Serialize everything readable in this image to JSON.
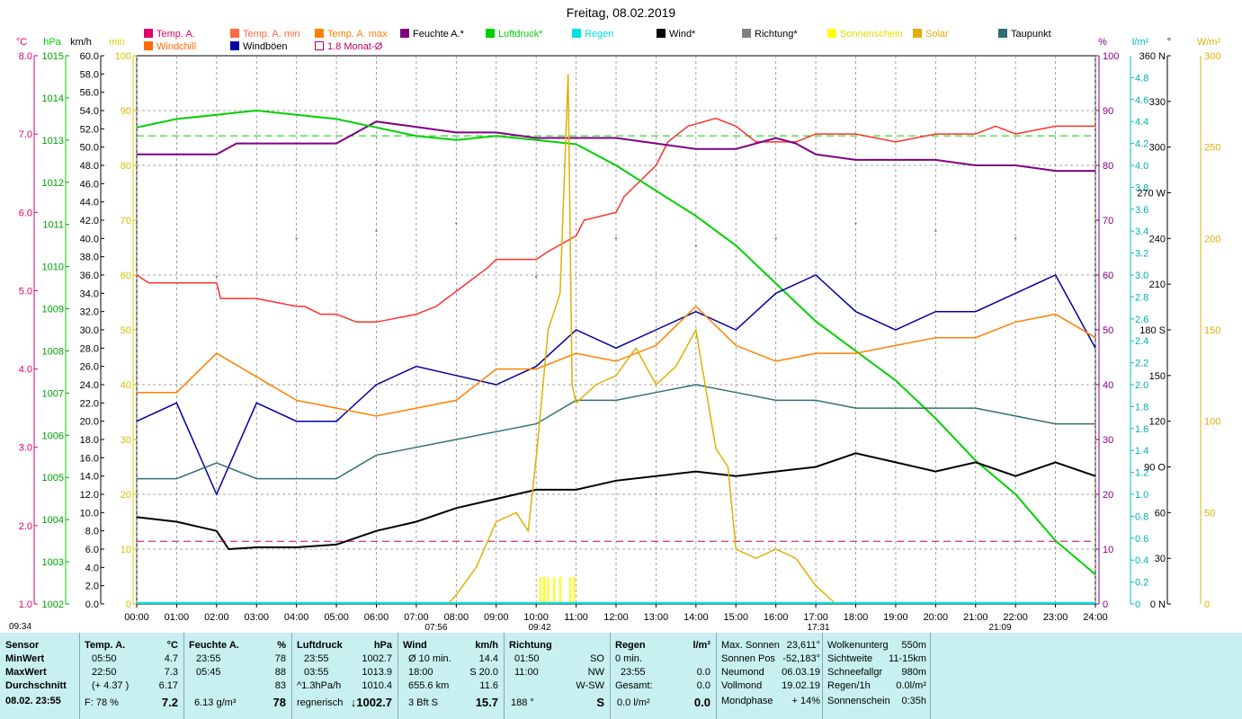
{
  "title": "Freitag, 08.02.2019",
  "legend": [
    {
      "label": "Temp. A.",
      "color": "#e0006a",
      "hollow": false
    },
    {
      "label": "Temp. A. min",
      "color": "#ff6a40",
      "hollow": false
    },
    {
      "label": "Temp. A. max",
      "color": "#ff8000",
      "hollow": false
    },
    {
      "label": "Feuchte A.*",
      "color": "#800080",
      "hollow": false
    },
    {
      "label": "Luftdruck*",
      "color": "#00d000",
      "hollow": false
    },
    {
      "label": "Regen",
      "color": "#00e0e0",
      "hollow": false
    },
    {
      "label": "Wind*",
      "color": "#000000",
      "hollow": false
    },
    {
      "label": "Richtung*",
      "color": "#808080",
      "hollow": false
    },
    {
      "label": "Sonnenschein",
      "color": "#ffff00",
      "hollow": false
    },
    {
      "label": "Solar",
      "color": "#e0b000",
      "hollow": false
    },
    {
      "label": "Taupunkt",
      "color": "#2e7070",
      "hollow": false
    },
    {
      "label": "Windchill",
      "color": "#ff6a00",
      "hollow": false
    },
    {
      "label": "Windböen",
      "color": "#0000a0",
      "hollow": false
    },
    {
      "label": "1.8 Monat-Ø",
      "color": "#c00060",
      "hollow": true
    }
  ],
  "axes": {
    "left_units": [
      "°C",
      "hPa",
      "km/h",
      "min"
    ],
    "right_units": [
      "%",
      "l/m²",
      "°",
      "W/m²"
    ],
    "temp_ticks": [
      "8.0",
      "7.0",
      "6.0",
      "5.0",
      "4.0",
      "3.0",
      "2.0",
      "1.0"
    ],
    "hpa_ticks": [
      "1015",
      "1014",
      "1013",
      "1012",
      "1011",
      "1010",
      "1009",
      "1008",
      "1007",
      "1006",
      "1005",
      "1004",
      "1003",
      "1002"
    ],
    "kmh_ticks": [
      "60.0",
      "58.0",
      "56.0",
      "54.0",
      "52.0",
      "50.0",
      "48.0",
      "46.0",
      "44.0",
      "42.0",
      "40.0",
      "38.0",
      "36.0",
      "34.0",
      "32.0",
      "30.0",
      "28.0",
      "26.0",
      "24.0",
      "22.0",
      "20.0",
      "18.0",
      "16.0",
      "14.0",
      "12.0",
      "10.0",
      "8.0",
      "6.0",
      "4.0",
      "2.0",
      "0.0"
    ],
    "min_ticks": [
      "100",
      "90",
      "80",
      "70",
      "60",
      "50",
      "40",
      "30",
      "20",
      "10",
      "0"
    ],
    "pct_ticks": [
      "100",
      "90",
      "80",
      "70",
      "60",
      "50",
      "40",
      "30",
      "20",
      "10",
      "0"
    ],
    "lm2_ticks": [
      "4.8",
      "4.6",
      "4.4",
      "4.2",
      "4.0",
      "3.8",
      "3.6",
      "3.4",
      "3.2",
      "3.0",
      "2.8",
      "2.6",
      "2.4",
      "2.2",
      "2.0",
      "1.8",
      "1.6",
      "1.4",
      "1.2",
      "1.0",
      "0.8",
      "0.6",
      "0.4",
      "0.2",
      "0"
    ],
    "deg_ticks": [
      "360 N",
      "330",
      "300",
      "270 W",
      "240",
      "210",
      "180 S",
      "150",
      "120",
      "90 O",
      "60",
      "30",
      "0 N"
    ],
    "wm2_ticks": [
      "300",
      "250",
      "200",
      "150",
      "100",
      "50",
      "0"
    ],
    "x_ticks": [
      "00:00",
      "01:00",
      "02:00",
      "03:00",
      "04:00",
      "05:00",
      "06:00",
      "07:00",
      "08:00",
      "09:00",
      "10:00",
      "11:00",
      "12:00",
      "13:00",
      "14:00",
      "15:00",
      "16:00",
      "17:00",
      "18:00",
      "19:00",
      "20:00",
      "21:00",
      "22:00",
      "23:00",
      "24:00"
    ],
    "sun_labels": [
      "09:34",
      "07:56",
      "09:42",
      "17:31",
      "21:09"
    ]
  },
  "chart_data": {
    "type": "line",
    "title": "Freitag, 08.02.2019",
    "x_unit": "hour of day",
    "xlim": [
      0,
      24
    ],
    "series": [
      {
        "name": "Temp. A.",
        "unit": "°C",
        "color": "#ff3030",
        "x": [
          0,
          0.3,
          1,
          2,
          2.1,
          3,
          4,
          4.2,
          4.6,
          5,
          5.5,
          6,
          7,
          7.5,
          8.8,
          9,
          10,
          10.3,
          11,
          11.2,
          12,
          12.2,
          13,
          13.3,
          13.8,
          14.5,
          15,
          15.5,
          16,
          16.5,
          17,
          17.5,
          18,
          19,
          20,
          21,
          21.5,
          22,
          23,
          23.5,
          24
        ],
        "y": [
          5.2,
          5.1,
          5.1,
          5.1,
          4.9,
          4.9,
          4.8,
          4.8,
          4.7,
          4.7,
          4.6,
          4.6,
          4.7,
          4.8,
          5.3,
          5.4,
          5.4,
          5.5,
          5.7,
          5.9,
          6.0,
          6.2,
          6.6,
          6.9,
          7.1,
          7.2,
          7.1,
          6.9,
          6.9,
          6.9,
          7.0,
          7.0,
          7.0,
          6.9,
          7.0,
          7.0,
          7.1,
          7.0,
          7.1,
          7.1,
          7.1
        ]
      },
      {
        "name": "Feuchte A.*",
        "unit": "%",
        "color": "#800080",
        "x": [
          0,
          2,
          2.5,
          4,
          5,
          5.5,
          6,
          7,
          8,
          9,
          10,
          11,
          12,
          13,
          14,
          15,
          16,
          16.5,
          17,
          18,
          19,
          20,
          21,
          22,
          23,
          24
        ],
        "y": [
          82,
          82,
          84,
          84,
          84,
          86,
          88,
          87,
          86,
          86,
          85,
          85,
          85,
          84,
          83,
          83,
          85,
          84,
          82,
          81,
          81,
          81,
          80,
          80,
          79,
          79
        ]
      },
      {
        "name": "Luftdruck*",
        "unit": "hPa",
        "color": "#00d000",
        "x": [
          0,
          1,
          2,
          3,
          4,
          5,
          6,
          7,
          8,
          9,
          10,
          11,
          12,
          13,
          14,
          15,
          16,
          17,
          18,
          19,
          20,
          21,
          22,
          23,
          24
        ],
        "y": [
          1013.3,
          1013.5,
          1013.6,
          1013.7,
          1013.6,
          1013.5,
          1013.3,
          1013.1,
          1013.0,
          1013.1,
          1013.0,
          1012.9,
          1012.4,
          1011.8,
          1011.2,
          1010.5,
          1009.6,
          1008.7,
          1008.0,
          1007.3,
          1006.4,
          1005.4,
          1004.6,
          1003.5,
          1002.7
        ]
      },
      {
        "name": "Wind*",
        "unit": "km/h",
        "color": "#000000",
        "x": [
          0,
          1,
          2,
          2.3,
          3,
          4,
          5,
          6,
          7,
          8,
          9,
          10,
          11,
          12,
          13,
          14,
          15,
          16,
          17,
          18,
          19,
          20,
          21,
          22,
          23,
          24
        ],
        "y": [
          9.5,
          9.0,
          8.0,
          6.0,
          6.2,
          6.2,
          6.5,
          8.0,
          9.0,
          10.5,
          11.5,
          12.5,
          12.5,
          13.5,
          14.0,
          14.5,
          14.0,
          14.5,
          15.0,
          16.5,
          15.5,
          14.5,
          15.5,
          14.0,
          15.5,
          14.0
        ]
      },
      {
        "name": "Windböen",
        "unit": "km/h",
        "color": "#0000a0",
        "x": [
          0,
          1,
          2,
          3,
          4,
          5,
          6,
          7,
          8,
          9,
          10,
          11,
          12,
          13,
          14,
          15,
          16,
          17,
          18,
          19,
          20,
          21,
          22,
          23,
          24
        ],
        "y": [
          20,
          22,
          12,
          22,
          20,
          20,
          24,
          26,
          25,
          24,
          26,
          30,
          28,
          30,
          32,
          30,
          34,
          36,
          32,
          30,
          32,
          32,
          34,
          36,
          28
        ]
      },
      {
        "name": "Windchill",
        "unit": "°C",
        "color": "#ff8000",
        "x": [
          0,
          1,
          2,
          3,
          4,
          5,
          6,
          7,
          8,
          9,
          10,
          11,
          12,
          13,
          14,
          15,
          16,
          17,
          18,
          19,
          20,
          21,
          22,
          23,
          24
        ],
        "y": [
          3.7,
          3.7,
          4.2,
          3.9,
          3.6,
          3.5,
          3.4,
          3.5,
          3.6,
          4.0,
          4.0,
          4.2,
          4.1,
          4.3,
          4.8,
          4.3,
          4.1,
          4.2,
          4.2,
          4.3,
          4.4,
          4.4,
          4.6,
          4.7,
          4.4
        ]
      },
      {
        "name": "Taupunkt",
        "unit": "°C",
        "color": "#2e7070",
        "x": [
          0,
          1,
          2,
          3,
          4,
          5,
          6,
          7,
          8,
          9,
          10,
          11,
          12,
          13,
          14,
          15,
          16,
          17,
          18,
          19,
          20,
          21,
          22,
          23,
          24
        ],
        "y": [
          2.6,
          2.6,
          2.8,
          2.6,
          2.6,
          2.6,
          2.9,
          3.0,
          3.1,
          3.2,
          3.3,
          3.6,
          3.6,
          3.7,
          3.8,
          3.7,
          3.6,
          3.6,
          3.5,
          3.5,
          3.5,
          3.5,
          3.4,
          3.3,
          3.3
        ]
      },
      {
        "name": "Solar",
        "unit": "W/m²",
        "color": "#e0b000",
        "x": [
          7.8,
          8.0,
          8.5,
          9.0,
          9.5,
          9.8,
          10.0,
          10.3,
          10.6,
          10.8,
          10.9,
          11.0,
          11.5,
          12.0,
          12.5,
          13.0,
          13.5,
          14.0,
          14.5,
          14.8,
          15.0,
          15.5,
          16.0,
          16.5,
          17.0,
          17.5
        ],
        "y": [
          0,
          5,
          20,
          45,
          50,
          40,
          80,
          150,
          170,
          290,
          120,
          110,
          120,
          125,
          140,
          120,
          130,
          150,
          85,
          75,
          30,
          25,
          30,
          25,
          10,
          0
        ]
      },
      {
        "name": "Richtung*",
        "unit": "°",
        "color": "#808080",
        "x": [
          0,
          2,
          4,
          6,
          8,
          10,
          12,
          14,
          16,
          18,
          20,
          22,
          24
        ],
        "y": [
          250,
          215,
          240,
          245,
          250,
          215,
          240,
          235,
          240,
          250,
          245,
          240,
          240
        ]
      }
    ],
    "reference_lines": [
      {
        "name": "1.8 Monat-Ø",
        "unit": "°C",
        "value": 1.8,
        "color": "#c00060",
        "style": "dashed"
      }
    ],
    "sunshine_bars": {
      "hours": [
        10.1,
        10.2,
        10.3,
        10.45,
        10.6,
        10.85,
        10.95
      ],
      "color": "#ffff00"
    }
  },
  "stats": {
    "col1": {
      "header": "Sensor",
      "rows": [
        "MinWert",
        "MaxWert",
        "Durchschnitt",
        "08.02. 23:55"
      ]
    },
    "col2": {
      "header": "Temp. A.",
      "unit": "°C",
      "rows": [
        [
          "05:50",
          "4.7"
        ],
        [
          "22:50",
          "7.3"
        ],
        [
          "(+ 4.37 )",
          "6.17"
        ],
        [
          "F: 78 %",
          "7.2"
        ]
      ]
    },
    "col3": {
      "header": "Feuchte A.",
      "unit": "%",
      "rows": [
        [
          "23:55",
          "78"
        ],
        [
          "05:45",
          "88"
        ],
        [
          "",
          "83"
        ],
        [
          "6.13 g/m³",
          "78"
        ]
      ]
    },
    "col4": {
      "header": "Luftdruck",
      "unit": "hPa",
      "rows": [
        [
          "23:55",
          "1002.7"
        ],
        [
          "03:55",
          "1013.9"
        ],
        [
          "^1.3hPa/h",
          "1010.4"
        ],
        [
          "regnerisch",
          "↓1002.7"
        ]
      ]
    },
    "col5": {
      "header": "Wind",
      "unit": "km/h",
      "rows": [
        [
          "Ø 10 min.",
          "14.4"
        ],
        [
          "18:00",
          "S 20.0"
        ],
        [
          "655.6 km",
          "11.6"
        ],
        [
          "3 Bft S",
          "15.7"
        ]
      ]
    },
    "col6": {
      "header": "Richtung",
      "unit": "",
      "rows": [
        [
          "01:50",
          "SO"
        ],
        [
          "11:00",
          "NW"
        ],
        [
          "",
          "W-SW"
        ],
        [
          "188 °",
          "S"
        ]
      ]
    },
    "col7": {
      "header": "Regen",
      "unit": "l/m²",
      "rows": [
        [
          "0 min.",
          ""
        ],
        [
          "23:55",
          "0.0"
        ],
        [
          "Gesamt:",
          "0.0"
        ],
        [
          "0.0 l/m²",
          "0.0"
        ]
      ]
    },
    "col8": {
      "rows": [
        [
          "Max. Sonnen",
          "23,611°"
        ],
        [
          "Sonnen Pos",
          "-52,183°"
        ],
        [
          "Neumond",
          "06.03.19"
        ],
        [
          "Vollmond",
          "19.02.19"
        ],
        [
          "Mondphase",
          "+ 14%"
        ]
      ]
    },
    "col9": {
      "rows": [
        [
          "Wolkenunterg",
          "550m"
        ],
        [
          "Sichtweite",
          "11-15km"
        ],
        [
          "Schneefallgr",
          "980m"
        ],
        [
          "Regen/1h",
          "0.0l/m²"
        ],
        [
          "Sonnenschein",
          "0:35h"
        ]
      ]
    }
  }
}
